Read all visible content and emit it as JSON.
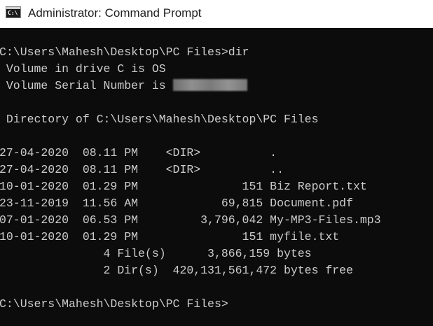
{
  "window": {
    "title": "Administrator: Command Prompt",
    "icon_glyph": "C:\\"
  },
  "console": {
    "lines": [
      "C:\\Users\\Mahesh\\Desktop\\PC Files>dir",
      " Volume in drive C is OS",
      " Volume Serial Number is ",
      "",
      " Directory of C:\\Users\\Mahesh\\Desktop\\PC Files",
      "",
      "27-04-2020  08.11 PM    <DIR>          .",
      "27-04-2020  08.11 PM    <DIR>          ..",
      "10-01-2020  01.29 PM               151 Biz Report.txt",
      "23-11-2019  11.56 AM            69,815 Document.pdf",
      "07-01-2020  06.53 PM         3,796,042 My-MP3-Files.mp3",
      "10-01-2020  01.29 PM               151 myfile.txt",
      "               4 File(s)      3,866,159 bytes",
      "               2 Dir(s)  420,131,561,472 bytes free",
      "",
      "C:\\Users\\Mahesh\\Desktop\\PC Files>"
    ]
  }
}
